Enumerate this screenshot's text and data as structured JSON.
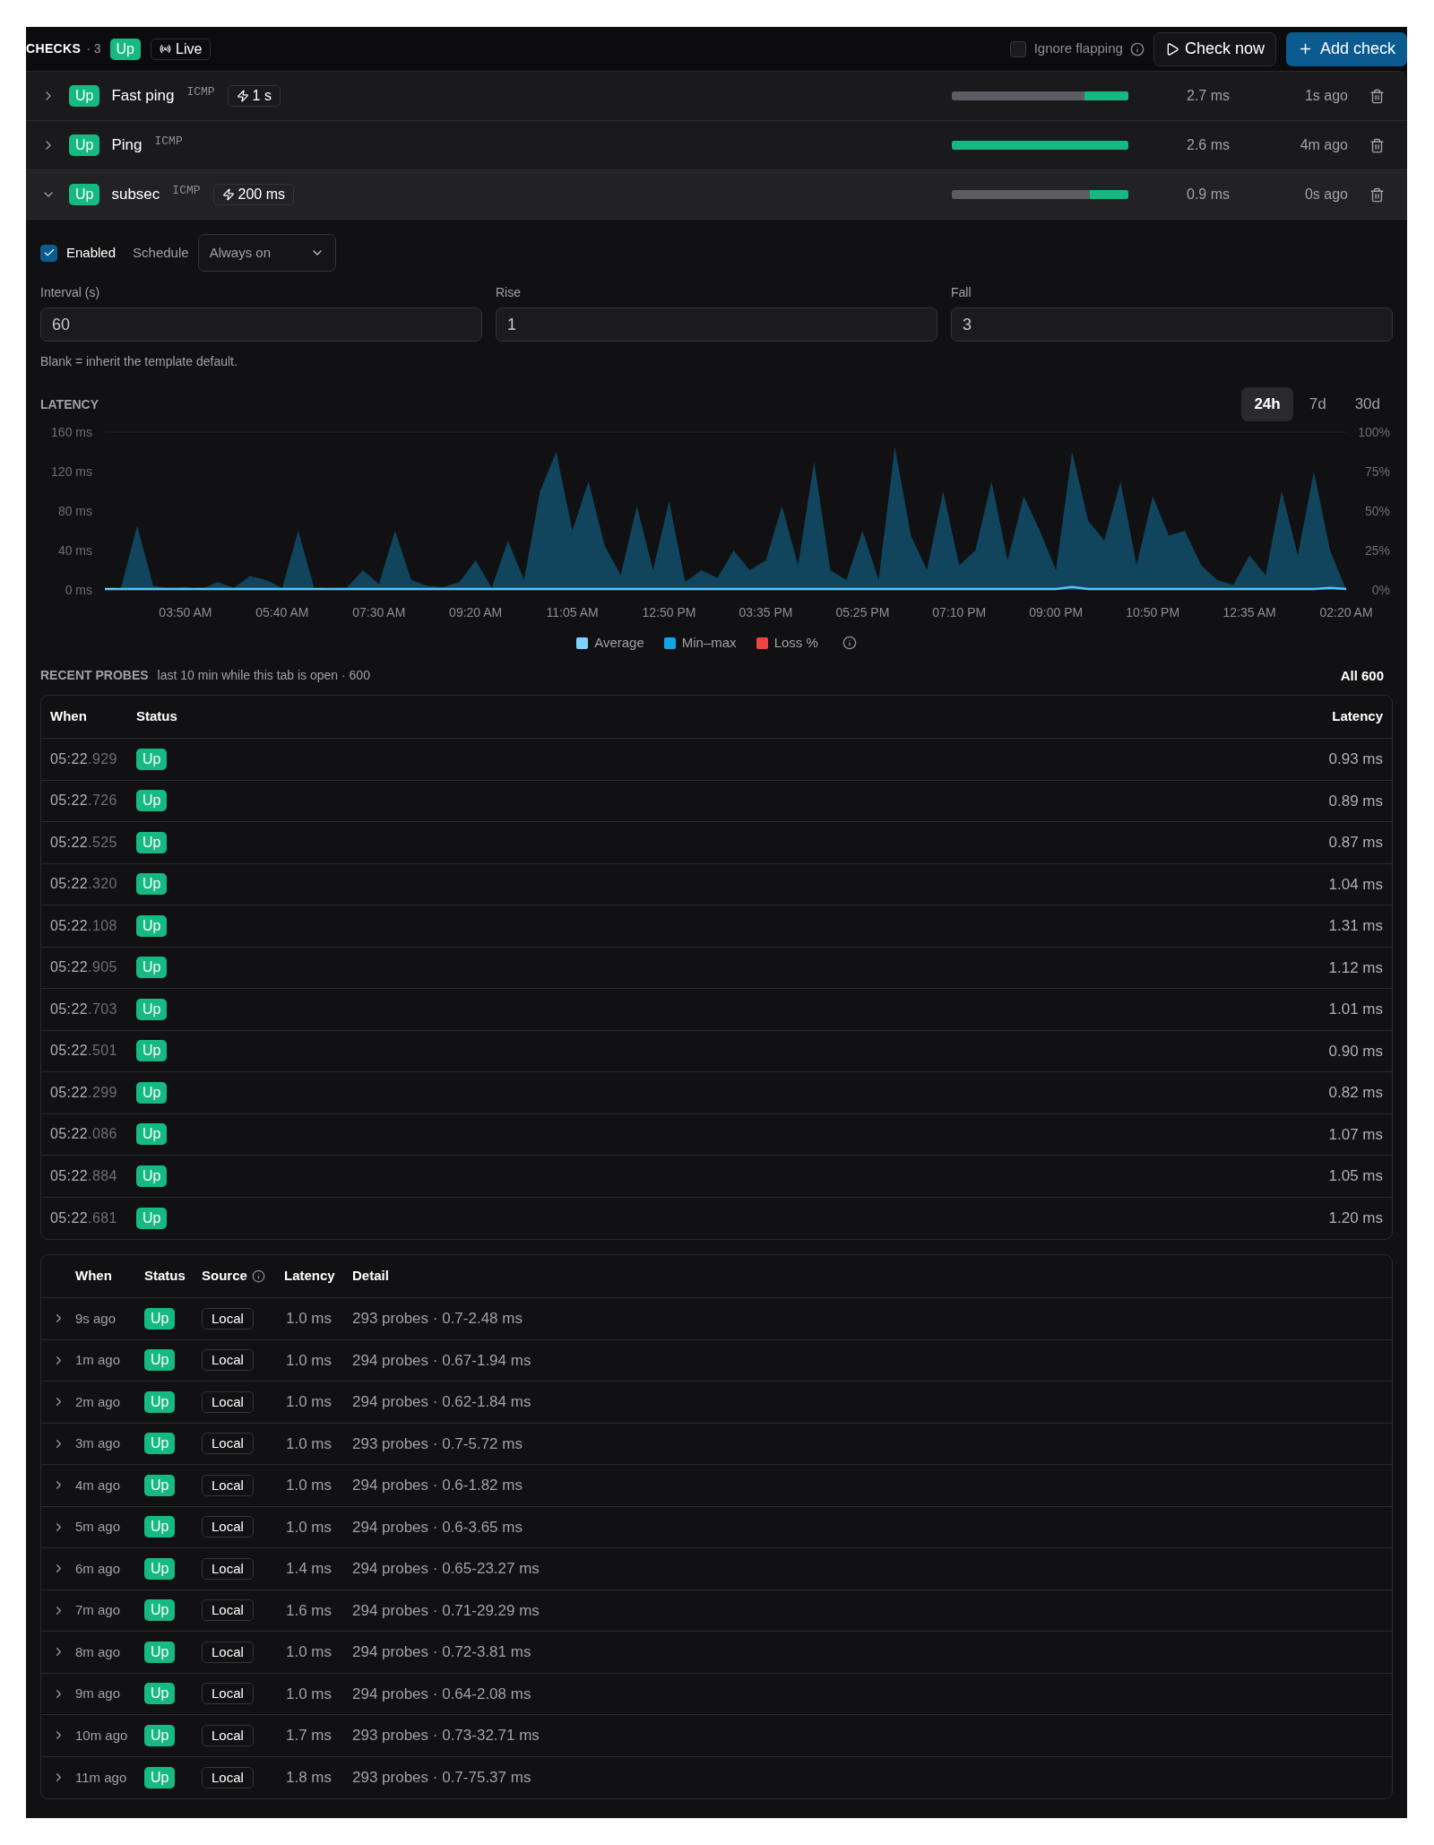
{
  "header": {
    "title": "CHECKS",
    "count": "· 3",
    "status": "Up",
    "live": "Live",
    "ignore_flapping": {
      "label": "Ignore flapping",
      "checked": false
    },
    "check_now": "Check now",
    "add_check": "Add check"
  },
  "checks": [
    {
      "name": "Fast ping",
      "status": "Up",
      "protocol": "ICMP",
      "interval": "1 s",
      "level": 0.25,
      "latency": "2.7 ms",
      "ago": "1s ago",
      "expanded": false
    },
    {
      "name": "Ping",
      "status": "Up",
      "protocol": "ICMP",
      "level": 1,
      "latency": "2.6 ms",
      "ago": "4m ago",
      "expanded": false
    },
    {
      "name": "subsec",
      "status": "Up",
      "protocol": "ICMP",
      "interval": "200 ms",
      "level": 0.22,
      "latency": "0.9 ms",
      "ago": "0s ago",
      "expanded": true
    }
  ],
  "settings": {
    "enabled": {
      "label": "Enabled",
      "checked": true
    },
    "schedule": {
      "label": "Schedule",
      "value": "Always on"
    },
    "fields": [
      {
        "label": "Interval (s)",
        "value": "60"
      },
      {
        "label": "Rise",
        "value": "1"
      },
      {
        "label": "Fall",
        "value": "3"
      }
    ],
    "hint": "Blank = inherit the template default."
  },
  "latency": {
    "title": "LATENCY",
    "ranges": [
      {
        "label": "24h",
        "selected": true
      },
      {
        "label": "7d",
        "selected": false
      },
      {
        "label": "30d",
        "selected": false
      }
    ],
    "chart_data": {
      "type": "area",
      "categories": [
        null,
        null,
        null,
        null,
        null,
        "03:50 AM",
        null,
        null,
        null,
        null,
        null,
        "05:40 AM",
        null,
        null,
        null,
        null,
        null,
        "07:30 AM",
        null,
        null,
        null,
        null,
        null,
        "09:20 AM",
        null,
        null,
        null,
        null,
        null,
        "11:05 AM",
        null,
        null,
        null,
        null,
        null,
        "12:50 PM",
        null,
        null,
        null,
        null,
        null,
        "03:35 PM",
        null,
        null,
        null,
        null,
        null,
        "05:25 PM",
        null,
        null,
        null,
        null,
        null,
        "07:10 PM",
        null,
        null,
        null,
        null,
        null,
        "09:00 PM",
        null,
        null,
        null,
        null,
        null,
        "10:50 PM",
        null,
        null,
        null,
        null,
        null,
        "12:35 AM",
        null,
        null,
        null,
        null,
        null,
        "02:20 AM"
      ],
      "ylim": [
        0,
        160
      ],
      "y2lim": [
        0,
        100
      ],
      "yticks": [
        {
          "value": 0,
          "label": "0 ms"
        },
        {
          "value": 40,
          "label": "40 ms"
        },
        {
          "value": 80,
          "label": "80 ms"
        },
        {
          "value": 120,
          "label": "120 ms"
        },
        {
          "value": 160,
          "label": "160 ms"
        }
      ],
      "y2ticks": [
        {
          "value": 0,
          "label": "0%"
        },
        {
          "value": 25,
          "label": "25%"
        },
        {
          "value": 50,
          "label": "50%"
        },
        {
          "value": 75,
          "label": "75%"
        },
        {
          "value": 100,
          "label": "100%"
        }
      ],
      "series": [
        {
          "name": "Average",
          "type": "line",
          "color": "#7dd3fc",
          "values": [
            1,
            1,
            1,
            1,
            1,
            1,
            1,
            1,
            1,
            1,
            1,
            1,
            1,
            1,
            1,
            1,
            1,
            1,
            1,
            1,
            1,
            1,
            1,
            1,
            1,
            1,
            1,
            1,
            1,
            1,
            1,
            1,
            1,
            1,
            1,
            1,
            1,
            1,
            1,
            1,
            1,
            1,
            1,
            1,
            1,
            1,
            1,
            1,
            1,
            1,
            1,
            1,
            1,
            1,
            1,
            1,
            1,
            1,
            1,
            1,
            3,
            1,
            1,
            1,
            1,
            1,
            1,
            1,
            1,
            1,
            1,
            1,
            1,
            1,
            1,
            1,
            2,
            1
          ]
        },
        {
          "name": "Min–max",
          "color": "#0ea5e9",
          "values": [
            0,
            2,
            65,
            4,
            2,
            3,
            1,
            8,
            2,
            14,
            10,
            2,
            60,
            1,
            2,
            2,
            20,
            6,
            60,
            10,
            4,
            3,
            8,
            30,
            2,
            50,
            10,
            100,
            140,
            60,
            110,
            45,
            15,
            85,
            20,
            90,
            8,
            20,
            12,
            40,
            20,
            30,
            85,
            25,
            130,
            20,
            10,
            60,
            10,
            145,
            55,
            20,
            100,
            25,
            40,
            110,
            30,
            95,
            60,
            20,
            140,
            70,
            50,
            110,
            25,
            95,
            55,
            60,
            25,
            10,
            5,
            35,
            15,
            100,
            35,
            120,
            40,
            0
          ]
        },
        {
          "name": "Loss %",
          "type": "line",
          "color": "#ef4444",
          "values": [
            null,
            null,
            null,
            null,
            null,
            null,
            null,
            null,
            null,
            null,
            null,
            null,
            null,
            null,
            null,
            null,
            null,
            null,
            null,
            null,
            null,
            null,
            null,
            null,
            null,
            null,
            null,
            null,
            null,
            null,
            null,
            null,
            null,
            null,
            null,
            null,
            null,
            null,
            null,
            null,
            null,
            null,
            null,
            null,
            null,
            null,
            null,
            null,
            null,
            null,
            null,
            null,
            null,
            null,
            null,
            null,
            null,
            null,
            null,
            null,
            null,
            null,
            null,
            null,
            null,
            null,
            null,
            null,
            null,
            null,
            null,
            null,
            null,
            null,
            null,
            null,
            null,
            null
          ]
        }
      ],
      "legend": "bottom"
    }
  },
  "recent_probes": {
    "title": "RECENT PROBES",
    "subtitle": "last 10 min while this tab is open · 600",
    "all": "All 600",
    "columns": [
      "When",
      "Status",
      "Latency"
    ],
    "rows": [
      {
        "time": "05:22",
        "ms": ".929",
        "status": "Up",
        "latency": "0.93 ms"
      },
      {
        "time": "05:22",
        "ms": ".726",
        "status": "Up",
        "latency": "0.89 ms"
      },
      {
        "time": "05:22",
        "ms": ".525",
        "status": "Up",
        "latency": "0.87 ms"
      },
      {
        "time": "05:22",
        "ms": ".320",
        "status": "Up",
        "latency": "1.04 ms"
      },
      {
        "time": "05:22",
        "ms": ".108",
        "status": "Up",
        "latency": "1.31 ms"
      },
      {
        "time": "05:22",
        "ms": ".905",
        "status": "Up",
        "latency": "1.12 ms"
      },
      {
        "time": "05:22",
        "ms": ".703",
        "status": "Up",
        "latency": "1.01 ms"
      },
      {
        "time": "05:22",
        "ms": ".501",
        "status": "Up",
        "latency": "0.90 ms"
      },
      {
        "time": "05:22",
        "ms": ".299",
        "status": "Up",
        "latency": "0.82 ms"
      },
      {
        "time": "05:22",
        "ms": ".086",
        "status": "Up",
        "latency": "1.07 ms"
      },
      {
        "time": "05:22",
        "ms": ".884",
        "status": "Up",
        "latency": "1.05 ms"
      },
      {
        "time": "05:22",
        "ms": ".681",
        "status": "Up",
        "latency": "1.20 ms"
      }
    ]
  },
  "history": {
    "columns": [
      "When",
      "Status",
      "Source",
      "Latency",
      "Detail"
    ],
    "rows": [
      {
        "when": "9s ago",
        "status": "Up",
        "source": "Local",
        "latency": "1.0 ms",
        "detail": "293 probes · 0.7-2.48 ms",
        "expanded": false
      },
      {
        "when": "1m ago",
        "status": "Up",
        "source": "Local",
        "latency": "1.0 ms",
        "detail": "294 probes · 0.67-1.94 ms",
        "expanded": false
      },
      {
        "when": "2m ago",
        "status": "Up",
        "source": "Local",
        "latency": "1.0 ms",
        "detail": "294 probes · 0.62-1.84 ms",
        "expanded": false
      },
      {
        "when": "3m ago",
        "status": "Up",
        "source": "Local",
        "latency": "1.0 ms",
        "detail": "293 probes · 0.7-5.72 ms",
        "expanded": false
      },
      {
        "when": "4m ago",
        "status": "Up",
        "source": "Local",
        "latency": "1.0 ms",
        "detail": "294 probes · 0.6-1.82 ms",
        "expanded": false
      },
      {
        "when": "5m ago",
        "status": "Up",
        "source": "Local",
        "latency": "1.0 ms",
        "detail": "294 probes · 0.6-3.65 ms",
        "expanded": false
      },
      {
        "when": "6m ago",
        "status": "Up",
        "source": "Local",
        "latency": "1.4 ms",
        "detail": "294 probes · 0.65-23.27 ms",
        "expanded": false
      },
      {
        "when": "7m ago",
        "status": "Up",
        "source": "Local",
        "latency": "1.6 ms",
        "detail": "294 probes · 0.71-29.29 ms",
        "expanded": false
      },
      {
        "when": "8m ago",
        "status": "Up",
        "source": "Local",
        "latency": "1.0 ms",
        "detail": "294 probes · 0.72-3.81 ms",
        "expanded": false
      },
      {
        "when": "9m ago",
        "status": "Up",
        "source": "Local",
        "latency": "1.0 ms",
        "detail": "294 probes · 0.64-2.08 ms",
        "expanded": false
      },
      {
        "when": "10m ago",
        "status": "Up",
        "source": "Local",
        "latency": "1.7 ms",
        "detail": "293 probes · 0.73-32.71 ms",
        "expanded": false
      },
      {
        "when": "11m ago",
        "status": "Up",
        "source": "Local",
        "latency": "1.8 ms",
        "detail": "293 probes · 0.7-75.37 ms",
        "expanded": false
      }
    ]
  }
}
